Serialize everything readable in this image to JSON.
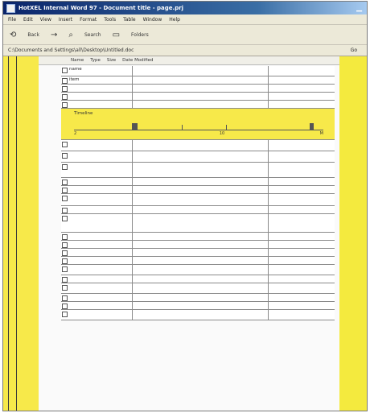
{
  "window": {
    "title": "HotXEL Internal Word 97 - Document title - page.prj"
  },
  "menubar": [
    "File",
    "Edit",
    "View",
    "Insert",
    "Format",
    "Tools",
    "Table",
    "Window",
    "Help"
  ],
  "toolbar": {
    "back_label": "Back",
    "forward_label": "",
    "search_label": "Search",
    "folders_label": "Folders"
  },
  "addressbar": {
    "address": "C:\\Documents and Settings\\all\\Desktop\\Untitled.doc",
    "go_label": "Go"
  },
  "panel": {
    "header_items": [
      "Name",
      "Type",
      "Size",
      "Date Modified"
    ]
  },
  "highlight_band": {
    "caption": "Timeline",
    "labels": [
      "2",
      "",
      "",
      "10",
      "",
      "M"
    ]
  },
  "rows": [
    [
      "name",
      "",
      ""
    ],
    [
      "item",
      "",
      ""
    ],
    [
      "",
      "",
      ""
    ],
    [
      "",
      "",
      ""
    ],
    [
      "",
      "",
      ""
    ],
    [
      "",
      "",
      ""
    ],
    [
      "",
      "",
      ""
    ],
    [
      "",
      "",
      ""
    ],
    [
      "",
      "",
      ""
    ],
    [
      "",
      "",
      ""
    ],
    [
      "",
      "",
      ""
    ],
    [
      "",
      "",
      ""
    ],
    [
      "",
      "",
      ""
    ],
    [
      "",
      "",
      ""
    ],
    [
      "",
      "",
      ""
    ],
    [
      "",
      "",
      ""
    ],
    [
      "",
      "",
      ""
    ],
    [
      "",
      "",
      ""
    ],
    [
      "",
      "",
      ""
    ],
    [
      "",
      "",
      ""
    ],
    [
      "",
      "",
      ""
    ],
    [
      "",
      "",
      ""
    ],
    [
      "",
      "",
      ""
    ]
  ]
}
